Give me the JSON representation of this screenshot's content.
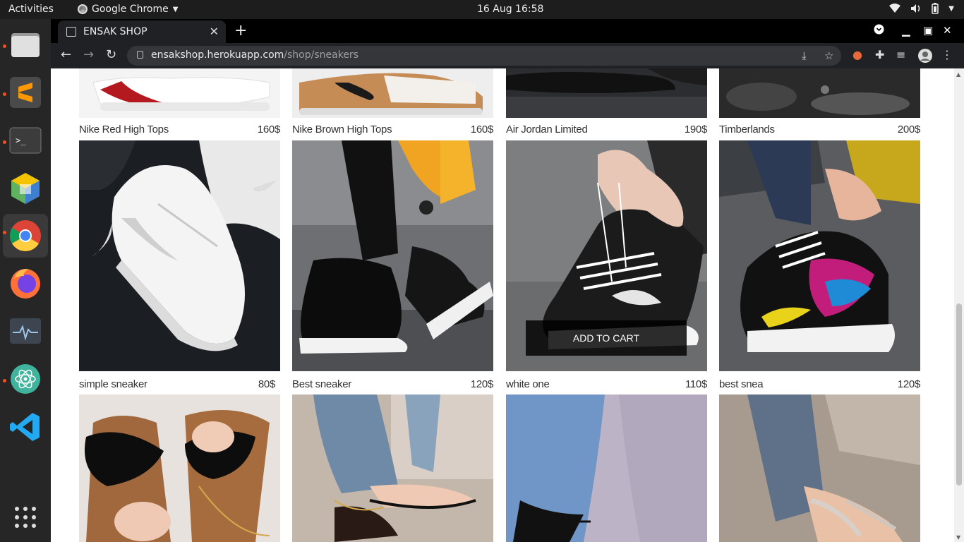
{
  "system": {
    "activities": "Activities",
    "app_name": "Google Chrome",
    "clock": "16 Aug  16:58"
  },
  "browser": {
    "tab_title": "ENSAK SHOP",
    "url_host": "ensakshop.herokuapp.com",
    "url_path": "/shop/sneakers"
  },
  "shop": {
    "add_to_cart": "ADD TO CART",
    "rows": [
      [
        {
          "name": "Nike Red High Tops",
          "price": "160$"
        },
        {
          "name": "Nike Brown High Tops",
          "price": "160$"
        },
        {
          "name": "Air Jordan Limited",
          "price": "190$"
        },
        {
          "name": "Timberlands",
          "price": "200$"
        }
      ],
      [
        {
          "name": "simple sneaker",
          "price": "80$"
        },
        {
          "name": "Best sneaker",
          "price": "120$"
        },
        {
          "name": "white one",
          "price": "110$"
        },
        {
          "name": "best snea",
          "price": "120$"
        }
      ]
    ]
  },
  "colors": {
    "accent_dot": "#e95420",
    "page_bg": "#ffffff",
    "chrome_dark": "#202124"
  }
}
